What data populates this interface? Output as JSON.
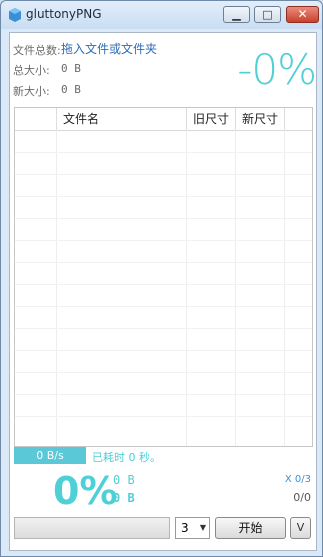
{
  "window": {
    "title": "gluttonyPNG"
  },
  "controls": {
    "minimize": "▭",
    "maximize": "▢",
    "close": "✕"
  },
  "info": {
    "files_label": "文件总数:",
    "files_link": "拖入文件或文件夹",
    "total_label": "总大小:",
    "total_value": "0 B",
    "new_label": "新大小:",
    "new_value": "0 B",
    "percent": "-0%"
  },
  "list": {
    "columns": [
      "文件名",
      "旧尺寸",
      "新尺寸"
    ],
    "rows": []
  },
  "status": {
    "speed": "0 B/s",
    "elapsed": "已耗时 0 秒。",
    "percent": "0%",
    "bytes_line1": "0 B",
    "bytes_line2": "0 B",
    "counter_top": "X 0/3",
    "counter_bottom": "0/0"
  },
  "footer": {
    "threads_value": "3",
    "start_label": "开始",
    "more_label": "V"
  },
  "colors": {
    "accent": "#4fcfd6",
    "link": "#2c6db6",
    "speed_bar": "#5bc8d8"
  }
}
